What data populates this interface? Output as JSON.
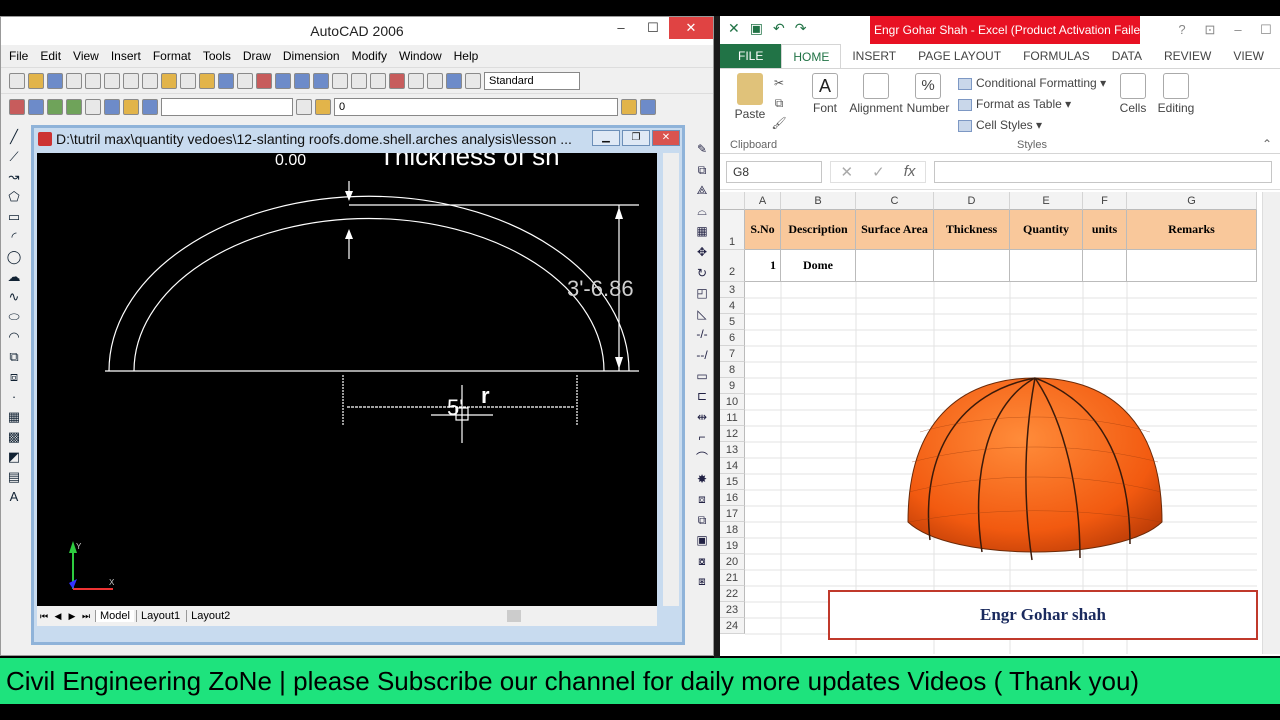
{
  "acad": {
    "title": "AutoCAD 2006",
    "menus": [
      "File",
      "Edit",
      "View",
      "Insert",
      "Format",
      "Tools",
      "Draw",
      "Dimension",
      "Modify",
      "Window",
      "Help"
    ],
    "style_select": "Standard",
    "layer_select": "0",
    "drawing_title": "D:\\tutril max\\quantity vedoes\\12-slanting roofs.dome.shell.arches analysis\\lesson ...",
    "tabs": [
      "Model",
      "Layout1",
      "Layout2"
    ],
    "annotations": {
      "top_text": "Thickness of sh",
      "top_dim": "0.00",
      "height_dim": "3'-6.86",
      "radius_dim": "5'",
      "radius_label": "r"
    }
  },
  "excel": {
    "title": "Engr Gohar Shah -  Excel (Product Activation Failed)",
    "ribbon_tabs": [
      "FILE",
      "HOME",
      "INSERT",
      "PAGE LAYOUT",
      "FORMULAS",
      "DATA",
      "REVIEW",
      "VIEW"
    ],
    "ribbon": {
      "paste": "Paste",
      "clipboard": "Clipboard",
      "font": "Font",
      "alignment": "Alignment",
      "number": "Number",
      "percent_glyph": "%",
      "conditional_formatting": "Conditional Formatting",
      "format_as_table": "Format as Table",
      "cell_styles": "Cell Styles",
      "styles": "Styles",
      "cells": "Cells",
      "editing": "Editing"
    },
    "name_box": "G8",
    "fx": "fx",
    "columns": [
      "A",
      "B",
      "C",
      "D",
      "E",
      "F",
      "G"
    ],
    "headers": [
      "S.No",
      "Description",
      "Surface Area",
      "Thickness",
      "Quantity",
      "units",
      "Remarks"
    ],
    "row2": {
      "sno": "1",
      "description": "Dome"
    },
    "row_numbers": [
      "1",
      "2",
      "3",
      "4",
      "5",
      "6",
      "7",
      "8",
      "9",
      "10",
      "11",
      "12",
      "13",
      "14",
      "15",
      "16",
      "17",
      "18",
      "19",
      "20",
      "21",
      "22",
      "23",
      "24"
    ],
    "author_box": "Engr Gohar shah",
    "dome_color": "#ff6a1a"
  },
  "banner": "Civil Engineering ZoNe | please Subscribe our channel for daily more updates Videos ( Thank you)"
}
